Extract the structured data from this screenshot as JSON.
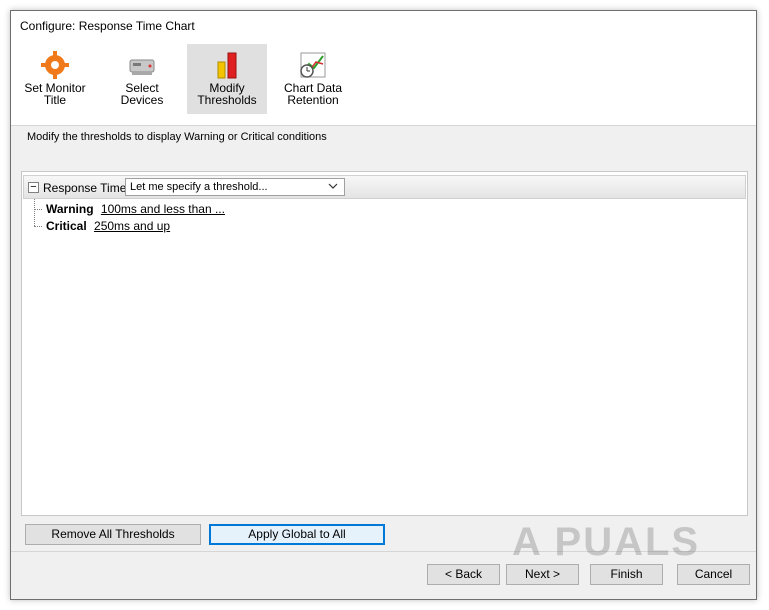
{
  "window": {
    "title": "Configure: Response Time Chart"
  },
  "steps": [
    {
      "line1": "Set Monitor",
      "line2": "Title",
      "icon": "gear-icon"
    },
    {
      "line1": "Select",
      "line2": "Devices",
      "icon": "device-icon"
    },
    {
      "line1": "Modify",
      "line2": "Thresholds",
      "icon": "thresholds-icon",
      "active": true
    },
    {
      "line1": "Chart Data",
      "line2": "Retention",
      "icon": "chart-retention-icon"
    }
  ],
  "instruction": "Modify the thresholds to display Warning or Critical conditions",
  "tree": {
    "node_label": "Response Time:",
    "select_value": "Let me specify a threshold...",
    "warning": {
      "label": "Warning",
      "value": "100ms and less than ..."
    },
    "critical": {
      "label": "Critical",
      "value": "250ms and up"
    }
  },
  "buttons": {
    "remove_all": "Remove All Thresholds",
    "apply_global": "Apply Global to All",
    "back": "< Back",
    "next": "Next >",
    "finish": "Finish",
    "cancel": "Cancel"
  },
  "watermark": "A PUALS",
  "colors": {
    "accent": "#0078d7",
    "warning": "#f5c400",
    "critical": "#e02020"
  }
}
